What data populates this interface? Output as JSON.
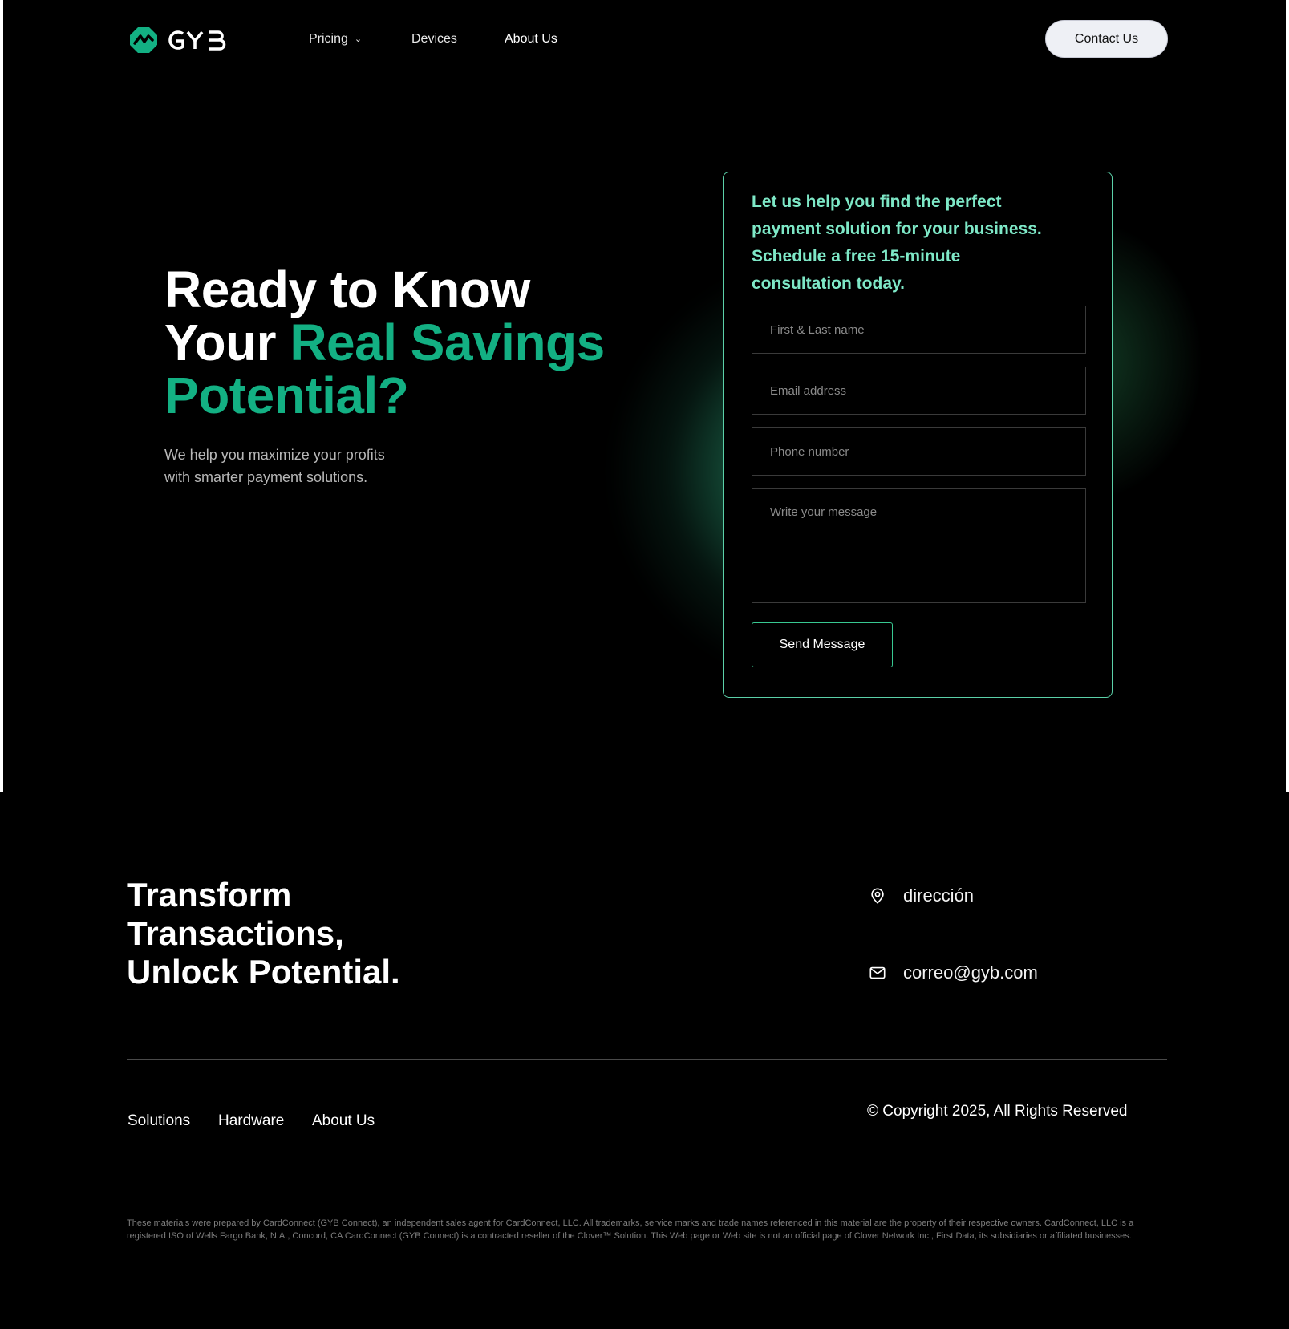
{
  "brand": {
    "name": "GYB",
    "accent": "#13b083",
    "glow": "#58c8a5"
  },
  "nav": {
    "items": [
      {
        "label": "Pricing",
        "has_dropdown": true
      },
      {
        "label": "Devices",
        "has_dropdown": false
      },
      {
        "label": "About Us",
        "has_dropdown": false
      }
    ],
    "cta": "Contact Us"
  },
  "hero": {
    "title_line1": "Ready to Know",
    "title_line2_white": "Your ",
    "title_line2_green": "Real Savings",
    "title_line3_green": "Potential?",
    "subtitle_line1": "We help you maximize your profits",
    "subtitle_line2": "with smarter payment solutions."
  },
  "form": {
    "title_lines": [
      "Let us help you find the perfect",
      "payment solution for your business.",
      "Schedule a free 15-minute",
      "consultation today."
    ],
    "name_placeholder": "First & Last name",
    "email_placeholder": "Email address",
    "phone_placeholder": "Phone number",
    "message_placeholder": "Write your message",
    "submit_label": "Send Message"
  },
  "footer": {
    "title_lines": [
      "Transform",
      "Transactions,",
      "Unlock Potential."
    ],
    "address": "dirección",
    "email": "correo@gyb.com",
    "links": [
      "Solutions",
      "Hardware",
      "About Us"
    ],
    "copyright": "© Copyright 2025, All Rights Reserved",
    "disclaimer": "These materials were prepared by CardConnect (GYB Connect), an independent sales agent for CardConnect, LLC. All trademarks, service marks and trade names referenced in this material are the property of their respective owners. CardConnect, LLC is a registered ISO of Wells Fargo Bank, N.A., Concord, CA CardConnect (GYB Connect) is a contracted reseller of the Clover™ Solution. This Web page or Web site is not an official page of Clover Network Inc., First Data, its subsidiaries or affiliated businesses."
  }
}
